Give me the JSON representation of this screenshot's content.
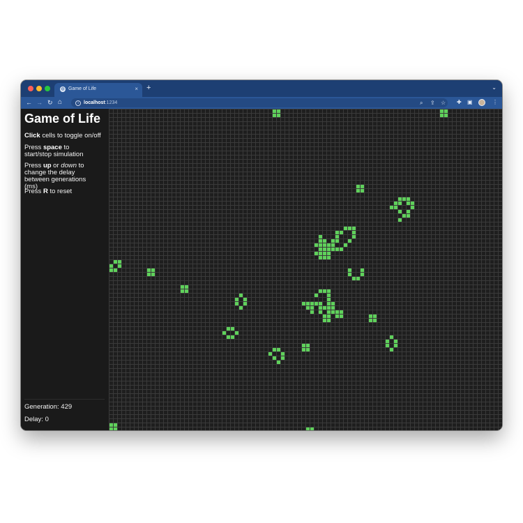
{
  "browser": {
    "tab_title": "Game of Life",
    "new_tab": "+",
    "tab_close": "×",
    "tab_menu": "⌄",
    "url_host": "localhost",
    "url_port": ":1234"
  },
  "sidebar": {
    "title": "Game of Life",
    "line1": {
      "bold": "Click",
      "rest": " cells to toggle on/off"
    },
    "line2": {
      "pre": "Press ",
      "bold": "space",
      "rest": " to start/stop simulation"
    },
    "line3": {
      "pre": "Press ",
      "bold": "up",
      "mid": " or ",
      "italic": "down",
      "rest": " to change the delay between generations (ms)"
    },
    "line4": {
      "pre": "Press ",
      "bold": "R",
      "rest": " to reset"
    },
    "generation_label": "Generation: 429",
    "delay_label": "Delay: 0"
  },
  "colors": {
    "cell_alive": "#5fd15b",
    "grid_bg": "#1e1e1e",
    "grid_line": "#3a3a3a",
    "tabbar": "#1d3f73",
    "toolbar": "#2b5797"
  },
  "grid": {
    "cols": 94,
    "rows": 77,
    "live_cells": [
      [
        39,
        0
      ],
      [
        40,
        0
      ],
      [
        39,
        1
      ],
      [
        40,
        1
      ],
      [
        79,
        0
      ],
      [
        80,
        0
      ],
      [
        79,
        1
      ],
      [
        80,
        1
      ],
      [
        59,
        18
      ],
      [
        60,
        18
      ],
      [
        59,
        19
      ],
      [
        60,
        19
      ],
      [
        69,
        21
      ],
      [
        70,
        21
      ],
      [
        71,
        21
      ],
      [
        68,
        22
      ],
      [
        69,
        22
      ],
      [
        71,
        22
      ],
      [
        72,
        22
      ],
      [
        67,
        23
      ],
      [
        68,
        23
      ],
      [
        72,
        23
      ],
      [
        69,
        24
      ],
      [
        71,
        24
      ],
      [
        70,
        25
      ],
      [
        71,
        25
      ],
      [
        69,
        26
      ],
      [
        56,
        28
      ],
      [
        57,
        28
      ],
      [
        58,
        28
      ],
      [
        55,
        29
      ],
      [
        58,
        29
      ],
      [
        50,
        30
      ],
      [
        54,
        29
      ],
      [
        54,
        30
      ],
      [
        58,
        30
      ],
      [
        50,
        31
      ],
      [
        51,
        31
      ],
      [
        53,
        31
      ],
      [
        54,
        31
      ],
      [
        57,
        31
      ],
      [
        49,
        32
      ],
      [
        50,
        32
      ],
      [
        51,
        32
      ],
      [
        52,
        32
      ],
      [
        53,
        32
      ],
      [
        56,
        32
      ],
      [
        50,
        33
      ],
      [
        51,
        33
      ],
      [
        52,
        33
      ],
      [
        53,
        33
      ],
      [
        54,
        33
      ],
      [
        55,
        33
      ],
      [
        49,
        34
      ],
      [
        50,
        34
      ],
      [
        51,
        34
      ],
      [
        52,
        34
      ],
      [
        50,
        35
      ],
      [
        51,
        35
      ],
      [
        52,
        35
      ],
      [
        1,
        36
      ],
      [
        2,
        36
      ],
      [
        0,
        37
      ],
      [
        2,
        37
      ],
      [
        0,
        38
      ],
      [
        1,
        38
      ],
      [
        9,
        38
      ],
      [
        10,
        38
      ],
      [
        9,
        39
      ],
      [
        10,
        39
      ],
      [
        57,
        38
      ],
      [
        60,
        38
      ],
      [
        57,
        39
      ],
      [
        60,
        39
      ],
      [
        58,
        40
      ],
      [
        59,
        40
      ],
      [
        17,
        42
      ],
      [
        18,
        42
      ],
      [
        17,
        43
      ],
      [
        18,
        43
      ],
      [
        50,
        43
      ],
      [
        51,
        43
      ],
      [
        52,
        43
      ],
      [
        31,
        44
      ],
      [
        49,
        44
      ],
      [
        52,
        44
      ],
      [
        30,
        45
      ],
      [
        32,
        45
      ],
      [
        52,
        44
      ],
      [
        52,
        45
      ],
      [
        30,
        46
      ],
      [
        32,
        46
      ],
      [
        46,
        46
      ],
      [
        47,
        46
      ],
      [
        48,
        46
      ],
      [
        49,
        46
      ],
      [
        50,
        46
      ],
      [
        52,
        46
      ],
      [
        53,
        46
      ],
      [
        31,
        47
      ],
      [
        47,
        47
      ],
      [
        48,
        47
      ],
      [
        50,
        47
      ],
      [
        51,
        47
      ],
      [
        52,
        47
      ],
      [
        53,
        47
      ],
      [
        48,
        48
      ],
      [
        50,
        48
      ],
      [
        52,
        48
      ],
      [
        53,
        48
      ],
      [
        54,
        48
      ],
      [
        55,
        48
      ],
      [
        51,
        49
      ],
      [
        52,
        49
      ],
      [
        54,
        49
      ],
      [
        55,
        49
      ],
      [
        62,
        49
      ],
      [
        63,
        49
      ],
      [
        51,
        50
      ],
      [
        52,
        50
      ],
      [
        62,
        50
      ],
      [
        63,
        50
      ],
      [
        28,
        52
      ],
      [
        29,
        52
      ],
      [
        27,
        53
      ],
      [
        30,
        53
      ],
      [
        28,
        54
      ],
      [
        29,
        54
      ],
      [
        67,
        54
      ],
      [
        66,
        55
      ],
      [
        68,
        55
      ],
      [
        46,
        56
      ],
      [
        47,
        56
      ],
      [
        66,
        56
      ],
      [
        68,
        56
      ],
      [
        39,
        57
      ],
      [
        40,
        57
      ],
      [
        46,
        57
      ],
      [
        47,
        57
      ],
      [
        67,
        57
      ],
      [
        38,
        58
      ],
      [
        41,
        58
      ],
      [
        39,
        59
      ],
      [
        41,
        59
      ],
      [
        40,
        60
      ],
      [
        0,
        75
      ],
      [
        1,
        75
      ],
      [
        0,
        76
      ],
      [
        1,
        76
      ],
      [
        47,
        76
      ],
      [
        48,
        76
      ]
    ]
  }
}
